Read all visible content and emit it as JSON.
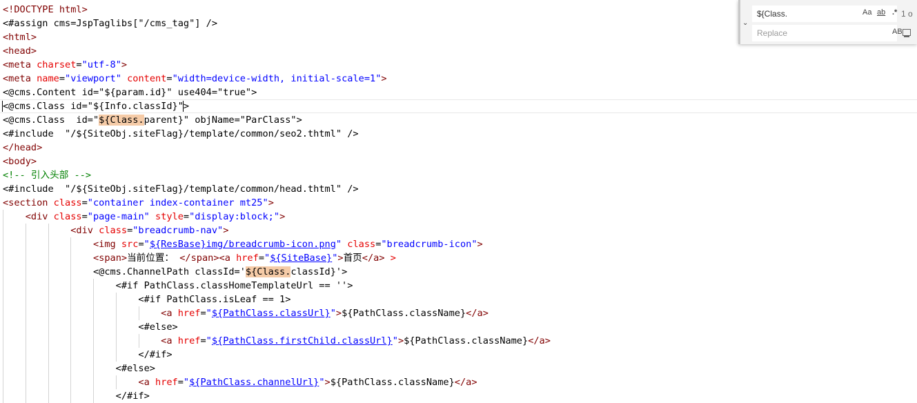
{
  "editor": {
    "lines": [
      [
        [
          "t-tag",
          "<!DOCTYPE html>"
        ]
      ],
      [
        [
          "t-plain",
          "<#assign cms=JspTaglibs[\"/cms_tag\"] />"
        ]
      ],
      [
        [
          "t-tag",
          "<html>"
        ]
      ],
      [
        [
          "t-tag",
          "<head>"
        ]
      ],
      [
        [
          "t-tag",
          "<meta "
        ],
        [
          "t-attr",
          "charset"
        ],
        [
          "t-plain",
          "="
        ],
        [
          "t-str",
          "\"utf-8\""
        ],
        [
          "t-tag",
          ">"
        ]
      ],
      [
        [
          "t-tag",
          "<meta "
        ],
        [
          "t-attr",
          "name"
        ],
        [
          "t-plain",
          "="
        ],
        [
          "t-str",
          "\"viewport\""
        ],
        [
          "t-plain",
          " "
        ],
        [
          "t-attr",
          "content"
        ],
        [
          "t-plain",
          "="
        ],
        [
          "t-str",
          "\"width=device-width, initial-scale=1\""
        ],
        [
          "t-tag",
          ">"
        ]
      ],
      [
        [
          "t-plain",
          "<@cms.Content id=\"${param.id}\" use404=\"true\">"
        ]
      ],
      [
        [
          "caret",
          ""
        ],
        [
          "t-plain",
          "<@cms.Class id=\"${Info.classId}\""
        ],
        [
          "caret",
          ""
        ],
        [
          "t-plain",
          ">"
        ]
      ],
      [
        [
          "t-plain",
          "<@cms.Class  id=\""
        ],
        [
          "hl",
          "${Class."
        ],
        [
          "t-plain",
          "parent}\" objName=\"ParClass\">"
        ]
      ],
      [
        [
          "t-plain",
          "<#include  \"/${SiteObj.siteFlag}/template/common/seo2.thtml\" />"
        ]
      ],
      [
        [
          "t-tag",
          "</head>"
        ]
      ],
      [
        [
          "t-tag",
          "<body>"
        ]
      ],
      [
        [
          "t-cmt",
          "<!-- 引入头部 -->"
        ]
      ],
      [
        [
          "t-plain",
          "<#include  \"/${SiteObj.siteFlag}/template/common/head.thtml\" />"
        ]
      ],
      [
        [
          "t-tag",
          "<section "
        ],
        [
          "t-attr",
          "class"
        ],
        [
          "t-plain",
          "="
        ],
        [
          "t-str",
          "\"container index-container mt25\""
        ],
        [
          "t-tag",
          ">"
        ]
      ],
      [
        [
          "t-plain",
          "    "
        ],
        [
          "t-tag",
          "<div "
        ],
        [
          "t-attr",
          "class"
        ],
        [
          "t-plain",
          "="
        ],
        [
          "t-str",
          "\"page-main\""
        ],
        [
          "t-plain",
          " "
        ],
        [
          "t-attr",
          "style"
        ],
        [
          "t-plain",
          "="
        ],
        [
          "t-str",
          "\"display:block;\""
        ],
        [
          "t-tag",
          ">"
        ]
      ],
      [
        [
          "t-plain",
          "            "
        ],
        [
          "t-tag",
          "<div "
        ],
        [
          "t-attr",
          "class"
        ],
        [
          "t-plain",
          "="
        ],
        [
          "t-str",
          "\"breadcrumb-nav\""
        ],
        [
          "t-tag",
          ">"
        ]
      ],
      [
        [
          "t-plain",
          "                "
        ],
        [
          "t-tag",
          "<img "
        ],
        [
          "t-attr",
          "src"
        ],
        [
          "t-plain",
          "="
        ],
        [
          "t-str",
          "\""
        ],
        [
          "t-link",
          "${ResBase}img/breadcrumb-icon.png"
        ],
        [
          "t-str",
          "\""
        ],
        [
          "t-plain",
          " "
        ],
        [
          "t-attr",
          "class"
        ],
        [
          "t-plain",
          "="
        ],
        [
          "t-str",
          "\"breadcrumb-icon\""
        ],
        [
          "t-tag",
          ">"
        ]
      ],
      [
        [
          "t-plain",
          "                "
        ],
        [
          "t-tag",
          "<span>"
        ],
        [
          "t-plain",
          "当前位置： "
        ],
        [
          "t-tag",
          "</span><a "
        ],
        [
          "t-attr",
          "href"
        ],
        [
          "t-plain",
          "="
        ],
        [
          "t-str",
          "\""
        ],
        [
          "t-link",
          "${SiteBase}"
        ],
        [
          "t-str",
          "\""
        ],
        [
          "t-tag",
          ">"
        ],
        [
          "t-plain",
          "首页"
        ],
        [
          "t-tag",
          "</a>"
        ],
        [
          "t-plain",
          " "
        ],
        [
          "t-attr",
          ">"
        ]
      ],
      [
        [
          "t-plain",
          "                <@cms.ChannelPath classId='"
        ],
        [
          "hl",
          "${Class."
        ],
        [
          "t-plain",
          "classId}'>"
        ]
      ],
      [
        [
          "t-plain",
          "                    <#if PathClass.classHomeTemplateUrl == ''>"
        ]
      ],
      [
        [
          "t-plain",
          "                        <#if PathClass.isLeaf == 1>"
        ]
      ],
      [
        [
          "t-plain",
          "                            "
        ],
        [
          "t-tag",
          "<a "
        ],
        [
          "t-attr",
          "href"
        ],
        [
          "t-plain",
          "="
        ],
        [
          "t-str",
          "\""
        ],
        [
          "t-link",
          "${PathClass.classUrl}"
        ],
        [
          "t-str",
          "\""
        ],
        [
          "t-tag",
          ">"
        ],
        [
          "t-plain",
          "${PathClass.className}"
        ],
        [
          "t-tag",
          "</a>"
        ]
      ],
      [
        [
          "t-plain",
          "                        <#else>"
        ]
      ],
      [
        [
          "t-plain",
          "                            "
        ],
        [
          "t-tag",
          "<a "
        ],
        [
          "t-attr",
          "href"
        ],
        [
          "t-plain",
          "="
        ],
        [
          "t-str",
          "\""
        ],
        [
          "t-link",
          "${PathClass.firstChild.classUrl}"
        ],
        [
          "t-str",
          "\""
        ],
        [
          "t-tag",
          ">"
        ],
        [
          "t-plain",
          "${PathClass.className}"
        ],
        [
          "t-tag",
          "</a>"
        ]
      ],
      [
        [
          "t-plain",
          "                        </#if>"
        ]
      ],
      [
        [
          "t-plain",
          "                    <#else>"
        ]
      ],
      [
        [
          "t-plain",
          "                        "
        ],
        [
          "t-tag",
          "<a "
        ],
        [
          "t-attr",
          "href"
        ],
        [
          "t-plain",
          "="
        ],
        [
          "t-str",
          "\""
        ],
        [
          "t-link",
          "${PathClass.channelUrl}"
        ],
        [
          "t-str",
          "\""
        ],
        [
          "t-tag",
          ">"
        ],
        [
          "t-plain",
          "${PathClass.className}"
        ],
        [
          "t-tag",
          "</a>"
        ]
      ],
      [
        [
          "t-plain",
          "                    </#if>"
        ]
      ]
    ],
    "current_line": 7
  },
  "find_widget": {
    "find_value": "${Class.",
    "replace_placeholder": "Replace",
    "match_case_label": "Aa",
    "whole_word_label": "ab",
    "regex_label": ".*",
    "preserve_case_label": "AB",
    "result_count": "1 o",
    "toggle_icon": "chevron-down-icon",
    "replace_all_icon": "replace-all-icon"
  }
}
